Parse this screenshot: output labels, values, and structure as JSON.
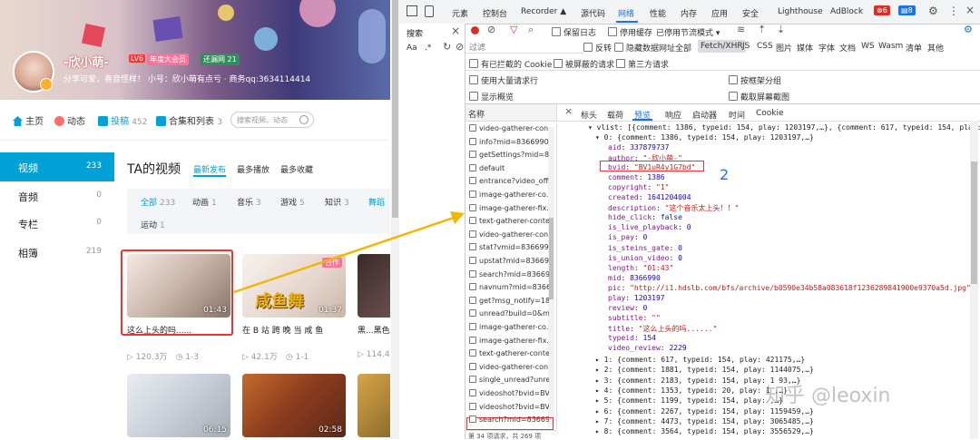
{
  "profile": {
    "username": "-欣小萌-",
    "level": "LV6",
    "vip": "年度大会员",
    "medal": "还漏网",
    "medal_level": "21",
    "sign": "分享可爱，喜音怪样！ 小号：欣小萌有点亏 · 商务qq:3634114414"
  },
  "nav": {
    "home": "主页",
    "dynamic": "动态",
    "videos": "投稿",
    "videos_count": "452",
    "collections": "合集和列表",
    "collections_count": "3",
    "search_placeholder": "搜索视频、动态"
  },
  "side": [
    {
      "label": "视频",
      "count": "233"
    },
    {
      "label": "音频",
      "count": "0"
    },
    {
      "label": "专栏",
      "count": "0"
    },
    {
      "label": "相簿",
      "count": "219"
    }
  ],
  "main": {
    "title": "TA的视频",
    "sorts": [
      "最新发布",
      "最多播放",
      "最多收藏"
    ],
    "categories": [
      {
        "label": "全部",
        "count": "233"
      },
      {
        "label": "动画",
        "count": "1"
      },
      {
        "label": "音乐",
        "count": "3"
      },
      {
        "label": "游戏",
        "count": "5"
      },
      {
        "label": "知识",
        "count": "3"
      },
      {
        "label": "舞蹈",
        "count": ""
      },
      {
        "label": "运动",
        "count": "1"
      }
    ],
    "videos": [
      {
        "title": "这么上头的吗......",
        "duration": "01:43",
        "plays": "120.3万",
        "date": "1-3"
      },
      {
        "title": "在 B 站 跨 晚 当 咸 鱼",
        "duration": "01:37",
        "plays": "42.1万",
        "date": "1-1",
        "tag": "合作",
        "overlay": "咸鱼舞"
      },
      {
        "title": "黑...黑色点",
        "duration": "",
        "plays": "114.4",
        "date": ""
      },
      {
        "title": "",
        "duration": "06:15",
        "plays": "",
        "date": ""
      },
      {
        "title": "",
        "duration": "02:58",
        "plays": "",
        "date": ""
      }
    ]
  },
  "devtools": {
    "tabs": [
      "元素",
      "控制台",
      "Recorder ▲",
      "源代码",
      "网络",
      "性能",
      "内存",
      "应用",
      "安全",
      "Lighthouse",
      "AdBlock"
    ],
    "errors": "6",
    "messages": "8",
    "search_tab": "搜索",
    "toolbar": {
      "preserve_log": "保留日志",
      "disable_cache": "停用缓存",
      "throttle": "已停用节流模式"
    },
    "filter_placeholder": "过滤",
    "filter_opts": [
      "反转",
      "隐藏数据网址",
      "全部",
      "Fetch/XHR",
      "JS",
      "CSS",
      "图片",
      "媒体",
      "字体",
      "文档",
      "WS",
      "Wasm",
      "清单",
      "其他"
    ],
    "checks1": [
      "有已拦截的 Cookie",
      "被屏蔽的请求",
      "第三方请求"
    ],
    "checks2": [
      "使用大量请求行",
      "按框架分组"
    ],
    "checks3": [
      "显示概览",
      "截取屏幕截图"
    ],
    "name_header": "名称",
    "requests": [
      "video-gatherer-con",
      "info?mid=8366990.",
      "getSettings?mid=8.",
      "default",
      "entrance?video_offs",
      "image-gatherer-co.",
      "image-gatherer-fix.",
      "text-gatherer-conte",
      "video-gatherer-con",
      "stat?vmid=8366990",
      "upstat?mid=83669.",
      "search?mid=83669.",
      "navnum?mid=8366",
      "get?msg_notify=18",
      "unread?build=0&m",
      "image-gatherer-co.",
      "image-gatherer-fix.",
      "text-gatherer-conte",
      "video-gatherer-con",
      "single_unread?unre",
      "videoshot?bvid=BV",
      "videoshot?bvid=BV",
      "search?mid=83669."
    ],
    "footer": "第 34 项请求，共 269 项",
    "detail_tabs": [
      "标头",
      "载荷",
      "预览",
      "响应",
      "启动器",
      "时间",
      "Cookie"
    ],
    "json": {
      "vlist_head": "vlist: [{comment: 1386, typeid: 154, play: 1203197,…}, {comment: 617, typeid: 154, play: 4",
      "item0_head": "0: {comment: 1386, typeid: 154, play: 1203197,…}",
      "fields": [
        [
          "aid",
          "337879737",
          "num"
        ],
        [
          "author",
          "\"-欣小萌-\"",
          "str"
        ],
        [
          "bvid",
          "\"BV1uR4y1G7bd\"",
          "str"
        ],
        [
          "comment",
          "1386",
          "num"
        ],
        [
          "copyright",
          "\"1\"",
          "str"
        ],
        [
          "created",
          "1641204004",
          "num"
        ],
        [
          "description",
          "\"这个音乐太上头！！\"",
          "str"
        ],
        [
          "hide_click",
          "false",
          "kw"
        ],
        [
          "is_live_playback",
          "0",
          "num"
        ],
        [
          "is_pay",
          "0",
          "num"
        ],
        [
          "is_steins_gate",
          "0",
          "num"
        ],
        [
          "is_union_video",
          "0",
          "num"
        ],
        [
          "length",
          "\"01:43\"",
          "str"
        ],
        [
          "mid",
          "8366990",
          "num"
        ],
        [
          "pic",
          "\"http://i1.hdslb.com/bfs/archive/b0590e34b58a083618f1236289841900e9370a5d.jpg\"",
          "str"
        ],
        [
          "play",
          "1203197",
          "num"
        ],
        [
          "review",
          "0",
          "num"
        ],
        [
          "subtitle",
          "\"\"",
          "str"
        ],
        [
          "title",
          "\"这么上头的吗......\"",
          "str"
        ],
        [
          "typeid",
          "154",
          "num"
        ],
        [
          "video_review",
          "2229",
          "num"
        ]
      ],
      "collapsed": [
        "1: {comment: 617, typeid: 154, play: 421175,…}",
        "2: {comment: 1881, typeid: 154, play: 1144075,…}",
        "3: {comment: 2183, typeid: 154, play: 1 93,…}",
        "4: {comment: 1353, typeid: 20, play: 1  ,…}",
        "5: {comment: 1199, typeid: 154, play:     ,…}",
        "6: {comment: 2267, typeid: 154, play: 1159459,…}",
        "7: {comment: 4473, typeid: 154, play: 3065485,…}",
        "8: {comment: 3564, typeid: 154, play: 3556529,…}"
      ]
    },
    "annotation_number": "2",
    "watermark": "知乎 @leoxin"
  },
  "colors": {
    "bili_blue": "#00a1d6",
    "pink": "#fb7299",
    "highlight_red": "#e33",
    "arrow": "#f2b705"
  }
}
